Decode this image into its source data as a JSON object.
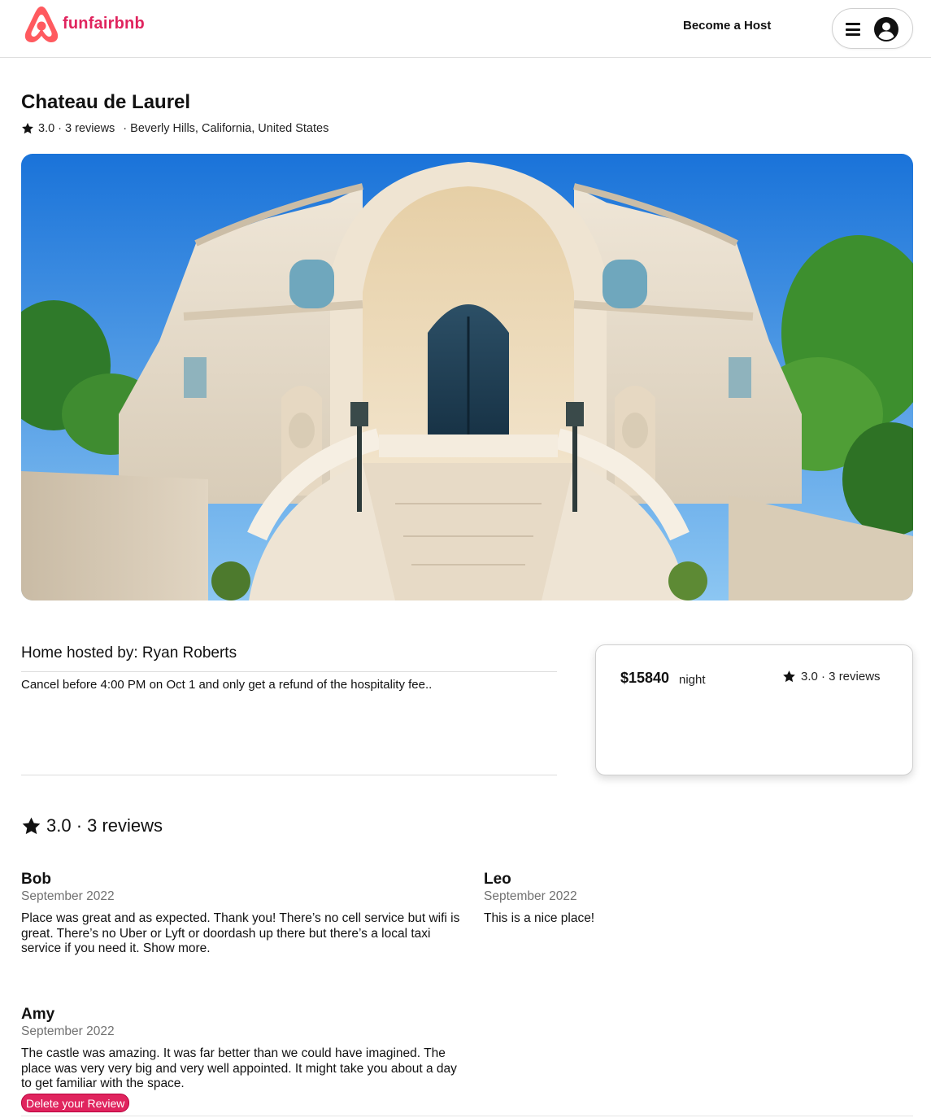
{
  "brand": {
    "name": "funfairbnb",
    "accent": "#e0245e",
    "logo_icon": "brand-logo-icon"
  },
  "header": {
    "become_host_label": "Become a Host",
    "menu_icon": "hamburger-icon",
    "avatar_icon": "user-circle-icon"
  },
  "listing": {
    "title": "Chateau de Laurel",
    "rating_text": "3.0 · 3 reviews",
    "location": "· Beverly Hills, California, United States"
  },
  "host": {
    "hosted_by": "Home hosted by: Ryan Roberts",
    "cancel_policy": "Cancel before 4:00 PM on Oct 1 and only get a refund of the hospitality fee.."
  },
  "booking": {
    "price": "$15840",
    "unit": "night",
    "rating_text": "3.0 · 3 reviews"
  },
  "reviews": {
    "heading": "3.0 · 3 reviews",
    "items": [
      {
        "name": "Bob",
        "date": "September 2022",
        "text": "Place was great and as expected. Thank you! There’s no cell service but wifi is great. There’s no Uber or Lyft or doordash up there but there’s a local taxi service if you need it. Show more."
      },
      {
        "name": "Leo",
        "date": "September 2022",
        "text": "This is a nice place!"
      },
      {
        "name": "Amy",
        "date": "September 2022",
        "text": "The castle was amazing. It was far better than we could have imagined. The place was very very big and very well appointed. It might take you about a day to get familiar with the space.",
        "delete_label": "Delete your Review"
      }
    ]
  }
}
